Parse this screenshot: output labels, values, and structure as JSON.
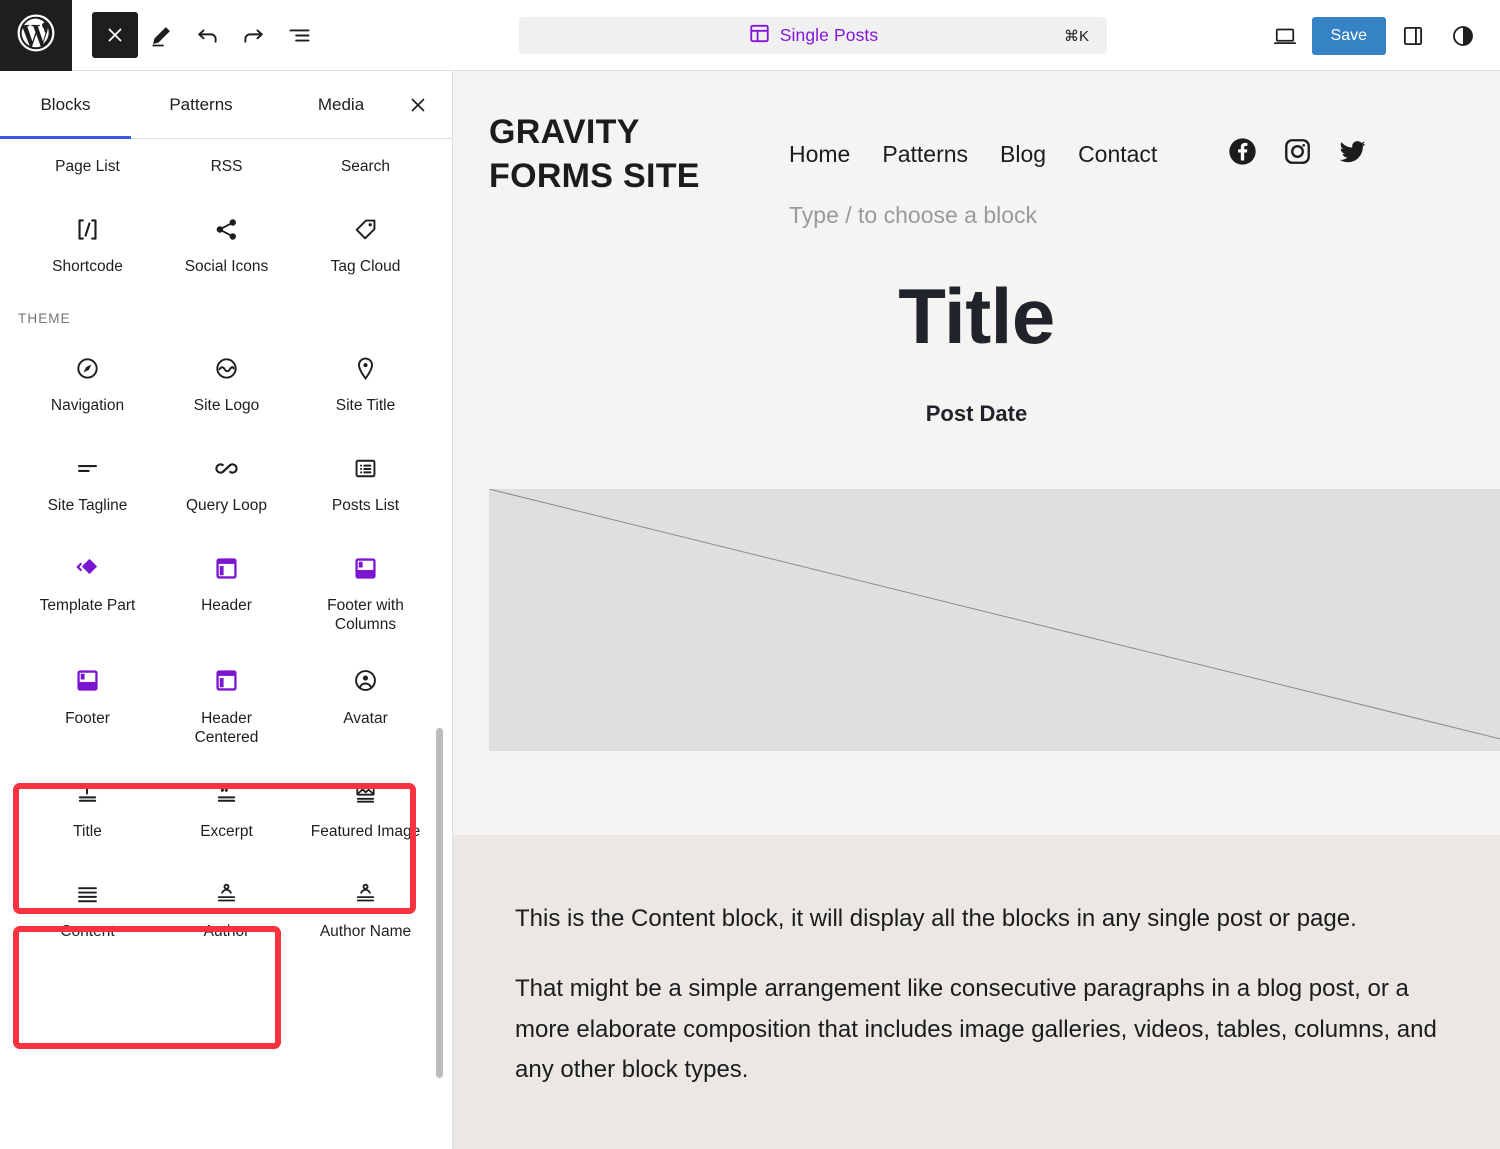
{
  "toolbar": {
    "wp_logo": "wordpress-logo",
    "left_buttons": [
      {
        "name": "close-icon",
        "label": "Close"
      },
      {
        "name": "edit-pencil-icon",
        "label": "Edit"
      },
      {
        "name": "undo-icon",
        "label": "Undo"
      },
      {
        "name": "redo-icon",
        "label": "Redo"
      },
      {
        "name": "list-view-icon",
        "label": "Document Overview"
      }
    ],
    "command_label": "Single Posts",
    "command_shortcut": "⌘K",
    "right_buttons": [
      {
        "name": "view-device-icon",
        "label": "View"
      },
      {
        "name": "settings-sidebar-icon",
        "label": "Settings"
      },
      {
        "name": "styles-contrast-icon",
        "label": "Styles"
      }
    ],
    "save_label": "Save",
    "save_color": "#3582c4",
    "accent_purple": "#8516d9"
  },
  "inserter": {
    "tabs": [
      {
        "label": "Blocks",
        "active": true
      },
      {
        "label": "Patterns",
        "active": false
      },
      {
        "label": "Media",
        "active": false
      }
    ],
    "close_label": "Close block inserter",
    "section_label": "THEME",
    "highlight_color": "#f8323f",
    "icon_purple": "#7a16d2",
    "rows": [
      [
        {
          "label": "Page List",
          "icon": "page-list-icon",
          "purple": false
        },
        {
          "label": "RSS",
          "icon": "rss-icon",
          "purple": false
        },
        {
          "label": "Search",
          "icon": "search-block-icon",
          "purple": false
        }
      ],
      [
        {
          "label": "Shortcode",
          "icon": "shortcode-icon",
          "purple": false
        },
        {
          "label": "Social Icons",
          "icon": "social-share-icon",
          "purple": false
        },
        {
          "label": "Tag Cloud",
          "icon": "tag-icon",
          "purple": false
        }
      ]
    ],
    "theme_rows": [
      [
        {
          "label": "Navigation",
          "icon": "compass-navigation-icon",
          "purple": false
        },
        {
          "label": "Site Logo",
          "icon": "site-logo-icon",
          "purple": false
        },
        {
          "label": "Site Title",
          "icon": "map-pin-icon",
          "purple": false
        }
      ],
      [
        {
          "label": "Site Tagline",
          "icon": "tagline-lines-icon",
          "purple": false
        },
        {
          "label": "Query Loop",
          "icon": "loop-infinity-icon",
          "purple": false
        },
        {
          "label": "Posts List",
          "icon": "posts-list-icon",
          "purple": false
        }
      ],
      [
        {
          "label": "Template Part",
          "icon": "template-part-icon",
          "purple": true
        },
        {
          "label": "Header",
          "icon": "header-layout-icon",
          "purple": true
        },
        {
          "label": "Footer with Columns",
          "icon": "footer-columns-icon",
          "purple": true
        }
      ],
      [
        {
          "label": "Footer",
          "icon": "footer-layout-icon",
          "purple": true
        },
        {
          "label": "Header Centered",
          "icon": "header-centered-icon",
          "purple": true
        },
        {
          "label": "Avatar",
          "icon": "avatar-icon",
          "purple": false
        }
      ],
      [
        {
          "label": "Title",
          "icon": "post-title-icon",
          "purple": false
        },
        {
          "label": "Excerpt",
          "icon": "excerpt-quote-icon",
          "purple": false
        },
        {
          "label": "Featured Image",
          "icon": "featured-image-icon",
          "purple": false
        }
      ],
      [
        {
          "label": "Content",
          "icon": "content-lines-icon",
          "purple": false
        },
        {
          "label": "Author",
          "icon": "author-icon",
          "purple": false
        },
        {
          "label": "Author Name",
          "icon": "author-name-icon",
          "purple": false
        }
      ]
    ]
  },
  "canvas": {
    "site_title_line1": "GRAVITY",
    "site_title_line2": "FORMS SITE",
    "nav": [
      {
        "label": "Home"
      },
      {
        "label": "Patterns"
      },
      {
        "label": "Blog"
      },
      {
        "label": "Contact"
      }
    ],
    "social": [
      {
        "name": "facebook-icon"
      },
      {
        "name": "instagram-icon"
      },
      {
        "name": "twitter-icon"
      }
    ],
    "block_placeholder": "Type / to choose a block",
    "post_title": "Title",
    "post_date": "Post Date",
    "featured_image_alt": "featured-image-placeholder",
    "content_paragraphs": [
      "This is the Content block, it will display all the blocks in any single post or page.",
      "That might be a simple arrangement like consecutive paragraphs in a blog post, or a more elaborate composition that includes image galleries, videos, tables, columns, and any other block types."
    ]
  }
}
